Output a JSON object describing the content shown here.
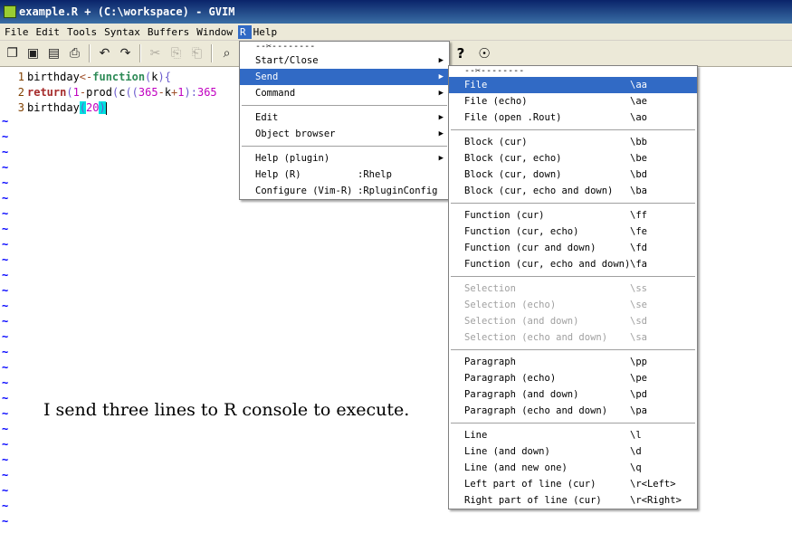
{
  "window": {
    "title": "example.R + (C:\\workspace) - GVIM"
  },
  "menubar": [
    {
      "label": "File"
    },
    {
      "label": "Edit"
    },
    {
      "label": "Tools"
    },
    {
      "label": "Syntax"
    },
    {
      "label": "Buffers"
    },
    {
      "label": "Window"
    },
    {
      "label": "R"
    },
    {
      "label": "Help"
    }
  ],
  "editor": {
    "lines": [
      {
        "num": "1",
        "tokens": [
          {
            "t": "birthday",
            "c": "c-id"
          },
          {
            "t": "<-",
            "c": "c-op"
          },
          {
            "t": "function",
            "c": "c-kw"
          },
          {
            "t": "(",
            "c": "c-paren"
          },
          {
            "t": "k",
            "c": "c-id"
          },
          {
            "t": "){",
            "c": "c-paren"
          }
        ]
      },
      {
        "num": "2",
        "tokens": [
          {
            "t": "return",
            "c": "c-ret"
          },
          {
            "t": "(",
            "c": "c-paren"
          },
          {
            "t": "1",
            "c": "c-num"
          },
          {
            "t": "-",
            "c": "c-op"
          },
          {
            "t": "prod",
            "c": "c-id"
          },
          {
            "t": "(",
            "c": "c-paren"
          },
          {
            "t": "c",
            "c": "c-id"
          },
          {
            "t": "((",
            "c": "c-paren"
          },
          {
            "t": "365",
            "c": "c-num"
          },
          {
            "t": "-",
            "c": "c-op"
          },
          {
            "t": "k",
            "c": "c-id"
          },
          {
            "t": "+",
            "c": "c-op"
          },
          {
            "t": "1",
            "c": "c-num"
          },
          {
            "t": "):",
            "c": "c-paren"
          },
          {
            "t": "365",
            "c": "c-num"
          }
        ]
      },
      {
        "num": "3",
        "tokens": [
          {
            "t": "birthday",
            "c": "c-id"
          },
          {
            "t": "(",
            "c": "c-paren c-hl"
          },
          {
            "t": "20",
            "c": "c-num"
          },
          {
            "t": ")",
            "c": "c-paren c-hl"
          }
        ]
      }
    ],
    "tilde": "~",
    "note": "I send three lines to R console to execute."
  },
  "r_menu": {
    "tearoff": "--✂--------",
    "groups": [
      [
        {
          "label": "Start/Close",
          "shortcut": "",
          "submenu": true
        },
        {
          "label": "Send",
          "shortcut": "",
          "submenu": true,
          "selected": true
        },
        {
          "label": "Command",
          "shortcut": "",
          "submenu": true
        }
      ],
      [
        {
          "label": "Edit",
          "shortcut": "",
          "submenu": true
        },
        {
          "label": "Object browser",
          "shortcut": "",
          "submenu": true
        }
      ],
      [
        {
          "label": "Help (plugin)",
          "shortcut": "",
          "submenu": true
        },
        {
          "label": "Help (R)",
          "shortcut": ":Rhelp"
        },
        {
          "label": "Configure (Vim-R)",
          "shortcut": ":RpluginConfig"
        }
      ]
    ]
  },
  "send_menu": {
    "tearoff": "--✂--------",
    "groups": [
      [
        {
          "label": "File",
          "shortcut": "\\aa",
          "selected": true
        },
        {
          "label": "File (echo)",
          "shortcut": "\\ae"
        },
        {
          "label": "File (open .Rout)",
          "shortcut": "\\ao"
        }
      ],
      [
        {
          "label": "Block (cur)",
          "shortcut": "\\bb"
        },
        {
          "label": "Block (cur, echo)",
          "shortcut": "\\be"
        },
        {
          "label": "Block (cur, down)",
          "shortcut": "\\bd"
        },
        {
          "label": "Block (cur, echo and down)",
          "shortcut": "\\ba"
        }
      ],
      [
        {
          "label": "Function (cur)",
          "shortcut": "\\ff"
        },
        {
          "label": "Function (cur, echo)",
          "shortcut": "\\fe"
        },
        {
          "label": "Function (cur and down)",
          "shortcut": "\\fd"
        },
        {
          "label": "Function (cur, echo and down)",
          "shortcut": "\\fa"
        }
      ],
      [
        {
          "label": "Selection",
          "shortcut": "\\ss",
          "disabled": true
        },
        {
          "label": "Selection (echo)",
          "shortcut": "\\se",
          "disabled": true
        },
        {
          "label": "Selection (and down)",
          "shortcut": "\\sd",
          "disabled": true
        },
        {
          "label": "Selection (echo and down)",
          "shortcut": "\\sa",
          "disabled": true
        }
      ],
      [
        {
          "label": "Paragraph",
          "shortcut": "\\pp"
        },
        {
          "label": "Paragraph (echo)",
          "shortcut": "\\pe"
        },
        {
          "label": "Paragraph (and down)",
          "shortcut": "\\pd"
        },
        {
          "label": "Paragraph (echo and down)",
          "shortcut": "\\pa"
        }
      ],
      [
        {
          "label": "Line",
          "shortcut": "\\l"
        },
        {
          "label": "Line (and down)",
          "shortcut": "\\d"
        },
        {
          "label": "Line (and new one)",
          "shortcut": "\\q"
        },
        {
          "label": "Left part of line (cur)",
          "shortcut": "\\r<Left>"
        },
        {
          "label": "Right part of line (cur)",
          "shortcut": "\\r<Right>"
        }
      ]
    ]
  },
  "toolbar": {
    "icons": [
      "open-icon",
      "save-icon",
      "save-all-icon",
      "print-icon",
      "undo-icon",
      "redo-icon",
      "cut-icon",
      "copy-icon",
      "paste-icon",
      "find-replace-icon"
    ],
    "glyphs": [
      "❐",
      "▣",
      "▤",
      "⎙",
      "↶",
      "↷",
      "✂",
      "⎘",
      "⎗",
      "⌕"
    ],
    "right_icons": [
      "help-icon",
      "find-help-icon"
    ],
    "right_glyphs": [
      "?",
      "☉"
    ]
  }
}
